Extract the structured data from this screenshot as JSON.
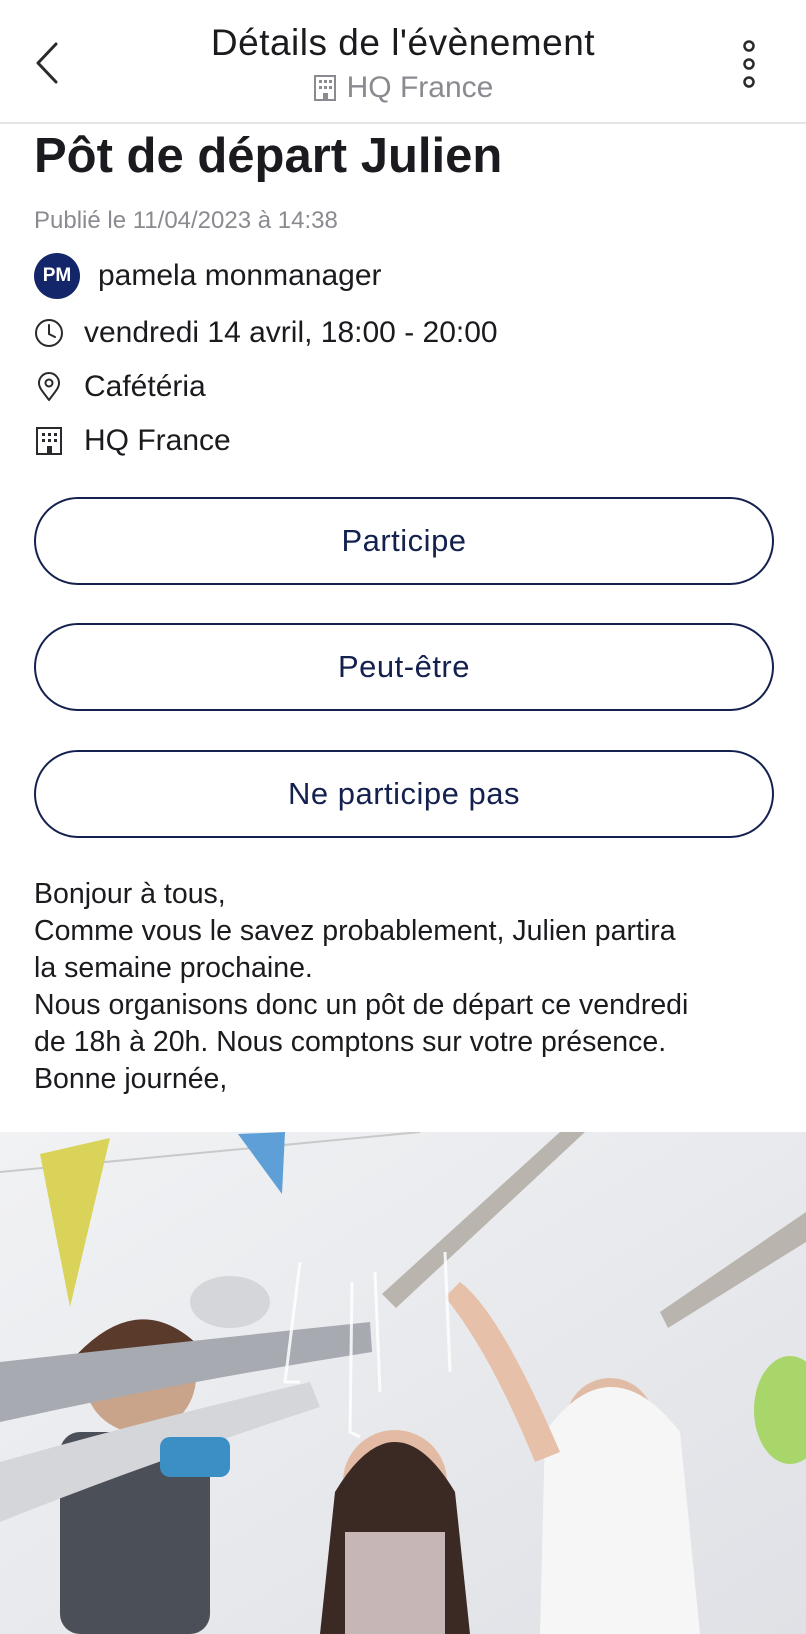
{
  "header": {
    "title": "Détails de l'évènement",
    "subtitle": "HQ France"
  },
  "event": {
    "title": "Pôt de départ Julien",
    "published": "Publié le 11/04/2023 à 14:38",
    "organizer_initials": "PM",
    "organizer_name": "pamela monmanager",
    "datetime": "vendredi 14 avril, 18:00 - 20:00",
    "location": "Cafétéria",
    "site": "HQ France"
  },
  "rsvp": {
    "yes": "Participe",
    "maybe": "Peut-être",
    "no": "Ne participe pas"
  },
  "description": [
    "Bonjour à tous,",
    "Comme vous le savez probablement, Julien partira",
    "la semaine prochaine.",
    "Nous organisons donc un pôt de départ ce vendredi",
    "de 18h à 20h. Nous comptons sur votre présence.",
    "Bonne journée,"
  ],
  "colors": {
    "accent": "#14214f",
    "avatar_bg": "#13266a",
    "muted_text": "#8a8a90"
  },
  "icons": {
    "back": "chevron-left-icon",
    "more": "more-vertical-icon",
    "building": "building-icon",
    "clock": "clock-icon",
    "location": "location-pin-icon"
  }
}
